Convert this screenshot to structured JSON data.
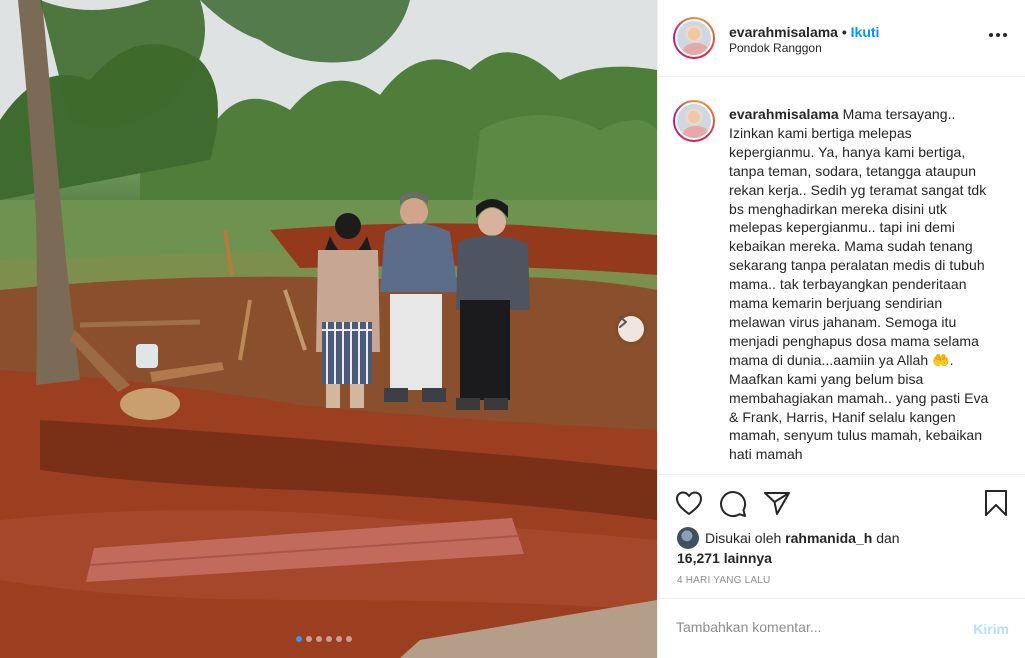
{
  "post": {
    "image_alt": "",
    "carousel": {
      "count": 6,
      "active_index": 0
    }
  },
  "header": {
    "username": "evarahmisalama",
    "separator": "•",
    "follow_label": "Ikuti",
    "location": "Pondok Ranggon"
  },
  "caption": {
    "username": "evarahmisalama",
    "text_before_emoji": "Mama tersayang.. Izinkan kami bertiga melepas kepergianmu. Ya, hanya kami bertiga, tanpa teman, sodara, tetangga ataupun rekan kerja.. Sedih yg teramat sangat tdk bs menghadirkan mereka disini utk melepas kepergianmu.. tapi ini demi kebaikan mereka. Mama sudah tenang sekarang tanpa peralatan medis di tubuh mama.. tak terbayangkan penderitaan mama kemarin berjuang sendirian melawan virus jahanam. Semoga itu menjadi penghapus dosa mama selama mama di dunia...aamiin ya Allah",
    "emoji": "🤲",
    "text_after_emoji": ". Maafkan kami yang belum bisa membahagiakan mamah.. yang pasti Eva & Frank, Harris, Hanif selalu kangen mamah, senyum tulus mamah, kebaikan hati mamah"
  },
  "likes": {
    "prefix": "Disukai oleh",
    "liker": "rahmanida_h",
    "connector": "dan",
    "others": "16,271 lainnya"
  },
  "timestamp": "4 HARI YANG LALU",
  "comment": {
    "placeholder": "Tambahkan komentar...",
    "post_label": "Kirim"
  },
  "colors": {
    "accent": "#0095f6",
    "post_disabled": "#b2dffc",
    "carousel_active": "#3897f0"
  },
  "icons": [
    "heart-icon",
    "comment-icon",
    "share-icon",
    "bookmark-icon",
    "more-icon",
    "chevron-right-icon"
  ]
}
